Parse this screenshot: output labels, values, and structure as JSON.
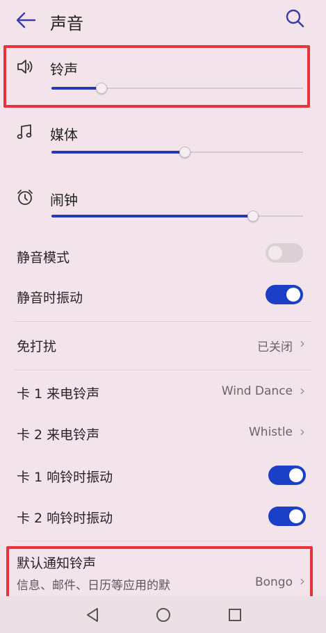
{
  "header": {
    "title": "声音",
    "back_icon": "back-arrow-icon",
    "search_icon": "search-icon"
  },
  "volumes": [
    {
      "label": "铃声",
      "icon": "speaker-icon",
      "level": 0.2
    },
    {
      "label": "媒体",
      "icon": "music-note-icon",
      "level": 0.53
    },
    {
      "label": "闹钟",
      "icon": "alarm-clock-icon",
      "level": 0.8
    }
  ],
  "toggles": {
    "silent_mode": {
      "label": "静音模式",
      "on": false
    },
    "vibrate_silent": {
      "label": "静音时振动",
      "on": true
    }
  },
  "dnd": {
    "label": "免打扰",
    "value": "已关闭"
  },
  "ringtones": {
    "sim1": {
      "label": "卡 1 来电铃声",
      "value": "Wind Dance"
    },
    "sim2": {
      "label": "卡 2 来电铃声",
      "value": "Whistle"
    }
  },
  "ring_vibrate": {
    "sim1": {
      "label": "卡 1 响铃时振动",
      "on": true
    },
    "sim2": {
      "label": "卡 2 响铃时振动",
      "on": true
    }
  },
  "notification": {
    "label": "默认通知铃声",
    "desc": "信息、邮件、日历等应用的默",
    "value": "Bongo"
  },
  "colors": {
    "accent": "#1c3fc7",
    "highlight": "#e8333a",
    "background": "#f2e4ea"
  }
}
